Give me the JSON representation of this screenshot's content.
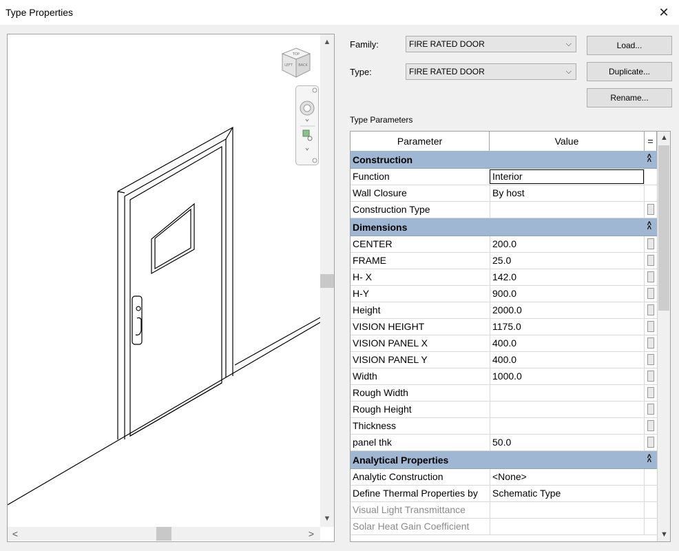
{
  "window": {
    "title": "Type Properties",
    "close_glyph": "✕"
  },
  "preview": {
    "viewcube_faces": [
      "TOP",
      "LEFT",
      "BACK"
    ],
    "scroll_up_glyph": "▲",
    "scroll_down_glyph": "▼",
    "scroll_left_glyph": "<",
    "scroll_right_glyph": ">"
  },
  "form": {
    "family_label": "Family:",
    "family_value": "FIRE RATED DOOR",
    "type_label": "Type:",
    "type_value": "FIRE RATED DOOR",
    "combo_arrow": "⌵"
  },
  "buttons": {
    "load": "Load...",
    "duplicate": "Duplicate...",
    "rename": "Rename..."
  },
  "type_parameters": {
    "section_label": "Type Parameters",
    "col_parameter": "Parameter",
    "col_value": "Value",
    "col_eq": "=",
    "groups": [
      {
        "name": "Construction",
        "rows": [
          {
            "param": "Function",
            "value": "Interior",
            "selected": true
          },
          {
            "param": "Wall Closure",
            "value": "By host"
          },
          {
            "param": "Construction Type",
            "value": "",
            "button": true
          }
        ]
      },
      {
        "name": "Dimensions",
        "rows": [
          {
            "param": "CENTER",
            "value": "200.0",
            "button": true
          },
          {
            "param": "FRAME",
            "value": "25.0",
            "button": true
          },
          {
            "param": "H- X",
            "value": "142.0",
            "button": true
          },
          {
            "param": "H-Y",
            "value": "900.0",
            "button": true
          },
          {
            "param": "Height",
            "value": "2000.0",
            "button": true
          },
          {
            "param": "VISION HEIGHT",
            "value": "1175.0",
            "button": true
          },
          {
            "param": "VISION PANEL X",
            "value": "400.0",
            "button": true
          },
          {
            "param": "VISION PANEL Y",
            "value": "400.0",
            "button": true
          },
          {
            "param": "Width",
            "value": "1000.0",
            "button": true
          },
          {
            "param": "Rough Width",
            "value": "",
            "button": true
          },
          {
            "param": "Rough Height",
            "value": "",
            "button": true
          },
          {
            "param": "Thickness",
            "value": "",
            "button": true
          },
          {
            "param": "panel thk",
            "value": "50.0",
            "button": true
          }
        ]
      },
      {
        "name": "Analytical Properties",
        "rows": [
          {
            "param": "Analytic Construction",
            "value": "<None>"
          },
          {
            "param": "Define Thermal Properties by",
            "value": "Schematic Type"
          },
          {
            "param": "Visual Light Transmittance",
            "value": "",
            "disabled": true
          },
          {
            "param": "Solar Heat Gain Coefficient",
            "value": "",
            "disabled": true
          }
        ]
      }
    ]
  }
}
